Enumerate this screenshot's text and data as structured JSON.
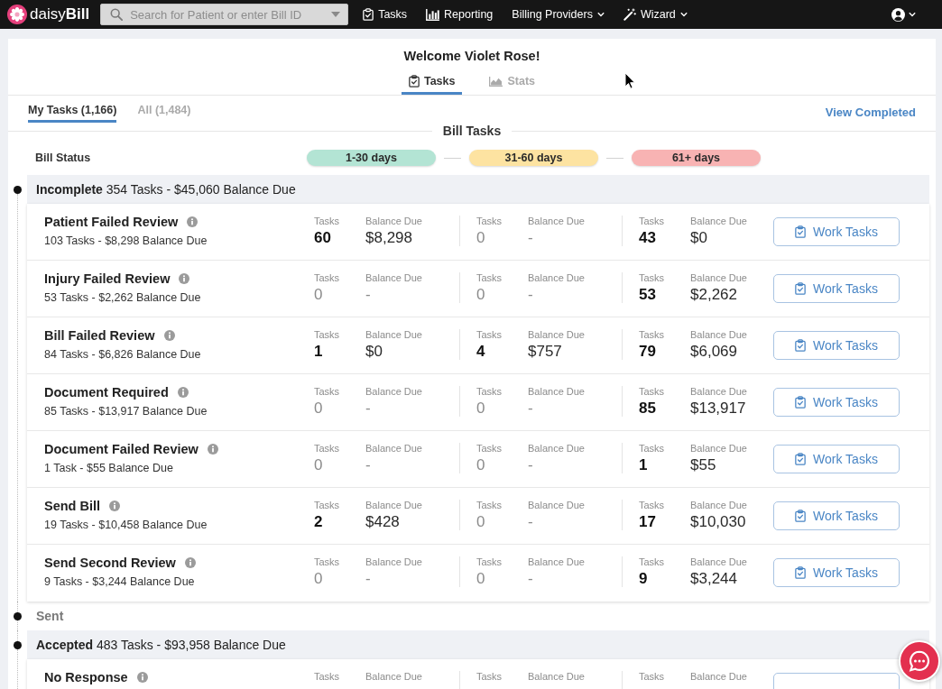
{
  "nav": {
    "logo": "daisy**Bill**",
    "search": {
      "placeholder": "Search for Patient or enter Bill ID"
    },
    "items": [
      {
        "label": "Tasks",
        "kind": "link"
      },
      {
        "label": "Reporting",
        "kind": "link"
      },
      {
        "label": "Billing Providers",
        "kind": "menu"
      },
      {
        "label": "Wizard",
        "kind": "menu"
      }
    ]
  },
  "header": {
    "welcome": "Welcome Violet Rose!",
    "tabs": [
      {
        "label": "Tasks",
        "selected": true
      },
      {
        "label": "Stats",
        "selected": false
      }
    ]
  },
  "subtabs": [
    {
      "label": "My Tasks (1,166)",
      "selected": true
    },
    {
      "label": "All (1,484)",
      "selected": false
    }
  ],
  "view_completed": "View Completed",
  "section_title": "Bill Tasks",
  "bill_status": {
    "label": "Bill Status",
    "ranges": [
      {
        "label": "1-30 days",
        "color": "#b3e4d4"
      },
      {
        "label": "31-60 days",
        "color": "#fde3a1"
      },
      {
        "label": "61+ days",
        "color": "#f8b3b3"
      }
    ]
  },
  "groups": [
    {
      "header": "**Incomplete** 354 Tasks - $45,060 Balance Due",
      "empty": false,
      "tasks": [
        {
          "title": "Patient Failed Review",
          "summary": "103 Tasks - $8,298 Balance Due",
          "action": "Work Tasks",
          "buckets": [
            {
              "tasks_label": "Tasks",
              "tasks": "60",
              "balance_label": "Balance Due",
              "balance": "$8,298",
              "empty": false
            },
            {
              "tasks_label": "Tasks",
              "tasks": "0",
              "balance_label": "Balance Due",
              "balance": "-",
              "empty": true
            },
            {
              "tasks_label": "Tasks",
              "tasks": "43",
              "balance_label": "Balance Due",
              "balance": "$0",
              "empty": false
            }
          ]
        },
        {
          "title": "Injury Failed Review",
          "summary": "53 Tasks - $2,262 Balance Due",
          "action": "Work Tasks",
          "buckets": [
            {
              "tasks_label": "Tasks",
              "tasks": "0",
              "balance_label": "Balance Due",
              "balance": "-",
              "empty": true
            },
            {
              "tasks_label": "Tasks",
              "tasks": "0",
              "balance_label": "Balance Due",
              "balance": "-",
              "empty": true
            },
            {
              "tasks_label": "Tasks",
              "tasks": "53",
              "balance_label": "Balance Due",
              "balance": "$2,262",
              "empty": false
            }
          ]
        },
        {
          "title": "Bill Failed Review",
          "summary": "84 Tasks - $6,826 Balance Due",
          "action": "Work Tasks",
          "buckets": [
            {
              "tasks_label": "Tasks",
              "tasks": "1",
              "balance_label": "Balance Due",
              "balance": "$0",
              "empty": false
            },
            {
              "tasks_label": "Tasks",
              "tasks": "4",
              "balance_label": "Balance Due",
              "balance": "$757",
              "empty": false
            },
            {
              "tasks_label": "Tasks",
              "tasks": "79",
              "balance_label": "Balance Due",
              "balance": "$6,069",
              "empty": false
            }
          ]
        },
        {
          "title": "Document Required",
          "summary": "85 Tasks - $13,917 Balance Due",
          "action": "Work Tasks",
          "buckets": [
            {
              "tasks_label": "Tasks",
              "tasks": "0",
              "balance_label": "Balance Due",
              "balance": "-",
              "empty": true
            },
            {
              "tasks_label": "Tasks",
              "tasks": "0",
              "balance_label": "Balance Due",
              "balance": "-",
              "empty": true
            },
            {
              "tasks_label": "Tasks",
              "tasks": "85",
              "balance_label": "Balance Due",
              "balance": "$13,917",
              "empty": false
            }
          ]
        },
        {
          "title": "Document Failed Review",
          "summary": "1 Task - $55 Balance Due",
          "action": "Work Tasks",
          "buckets": [
            {
              "tasks_label": "Tasks",
              "tasks": "0",
              "balance_label": "Balance Due",
              "balance": "-",
              "empty": true
            },
            {
              "tasks_label": "Tasks",
              "tasks": "0",
              "balance_label": "Balance Due",
              "balance": "-",
              "empty": true
            },
            {
              "tasks_label": "Tasks",
              "tasks": "1",
              "balance_label": "Balance Due",
              "balance": "$55",
              "empty": false
            }
          ]
        },
        {
          "title": "Send Bill",
          "summary": "19 Tasks - $10,458 Balance Due",
          "action": "Work Tasks",
          "buckets": [
            {
              "tasks_label": "Tasks",
              "tasks": "2",
              "balance_label": "Balance Due",
              "balance": "$428",
              "empty": false
            },
            {
              "tasks_label": "Tasks",
              "tasks": "0",
              "balance_label": "Balance Due",
              "balance": "-",
              "empty": true
            },
            {
              "tasks_label": "Tasks",
              "tasks": "17",
              "balance_label": "Balance Due",
              "balance": "$10,030",
              "empty": false
            }
          ]
        },
        {
          "title": "Send Second Review",
          "summary": "9 Tasks - $3,244 Balance Due",
          "action": "Work Tasks",
          "buckets": [
            {
              "tasks_label": "Tasks",
              "tasks": "0",
              "balance_label": "Balance Due",
              "balance": "-",
              "empty": true
            },
            {
              "tasks_label": "Tasks",
              "tasks": "0",
              "balance_label": "Balance Due",
              "balance": "-",
              "empty": true
            },
            {
              "tasks_label": "Tasks",
              "tasks": "9",
              "balance_label": "Balance Due",
              "balance": "$3,244",
              "empty": false
            }
          ]
        }
      ]
    },
    {
      "header": "Sent",
      "empty": true
    },
    {
      "header": "**Accepted** 483 Tasks - $93,958 Balance Due",
      "empty": false,
      "tasks": [
        {
          "title": "No Response",
          "buckets": [
            {
              "tasks_label": "Tasks",
              "balance_label": "Balance Due"
            },
            {
              "tasks_label": "Tasks",
              "balance_label": "Balance Due"
            },
            {
              "tasks_label": "Tasks",
              "balance_label": "Balance Due"
            }
          ]
        }
      ]
    }
  ]
}
